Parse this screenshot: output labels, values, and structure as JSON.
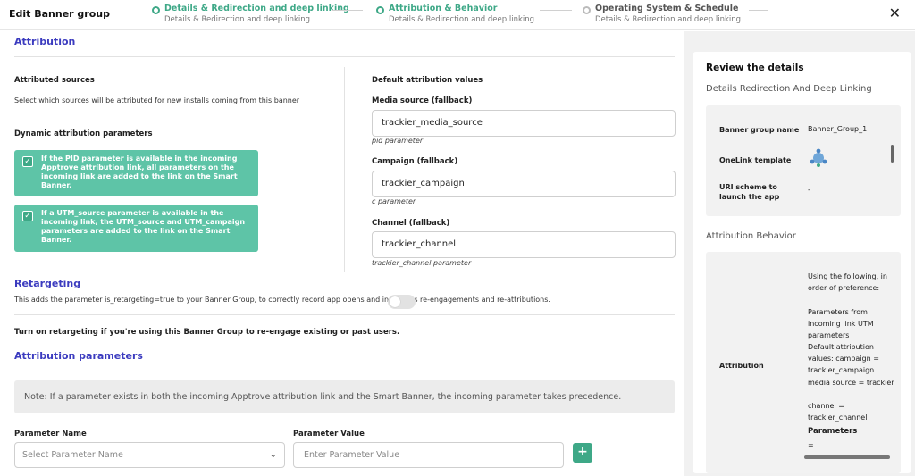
{
  "header": {
    "title": "Edit Banner group",
    "close": "✕",
    "steps": [
      {
        "title": "Details & Redirection and deep linking",
        "subtitle": "Details & Redirection and deep linking"
      },
      {
        "title": "Attribution & Behavior",
        "subtitle": "Details & Redirection and deep linking"
      },
      {
        "title": "Operating System & Schedule",
        "subtitle": "Details & Redirection and deep linking"
      }
    ]
  },
  "attribution": {
    "heading": "Attribution",
    "sources_label": "Attributed sources",
    "sources_desc": "Select which sources will be attributed for new installs coming from this banner",
    "dynamic_label": "Dynamic attribution parameters",
    "checkboxes": [
      {
        "text": "If the PID parameter is available in the incoming Apptrove attribution link, all parameters on the incoming link are added to the link on the Smart Banner.",
        "checked": true
      },
      {
        "text": "If a UTM_source parameter is available in the incoming link, the UTM_source and UTM_campaign parameters are added to the link on the Smart Banner.",
        "checked": true
      }
    ],
    "defaults_label": "Default attribution values",
    "fields": [
      {
        "label": "Media source (fallback)",
        "value": "trackier_media_source",
        "hint": "pid parameter"
      },
      {
        "label": "Campaign (fallback)",
        "value": "trackier_campaign",
        "hint": "c parameter"
      },
      {
        "label": "Channel (fallback)",
        "value": "trackier_channel",
        "hint": "trackier_channel parameter"
      }
    ]
  },
  "retargeting": {
    "heading": "Retargeting",
    "desc": "This adds the parameter is_retargeting=true to your Banner Group, to correctly record app opens and installs as re-engagements and re-attributions.",
    "toggle_label": "Turn on retargeting if you're using this Banner Group to re-engage existing or past users.",
    "enabled": false
  },
  "params": {
    "heading": "Attribution parameters",
    "note": "Note: If a parameter exists in both the incoming Apptrove attribution link and the Smart Banner, the incoming parameter takes precedence.",
    "name_label": "Parameter Name",
    "value_label": "Parameter Value",
    "name_placeholder": "Select Parameter Name",
    "value_placeholder": "Enter Parameter Value",
    "add": "+"
  },
  "review": {
    "title": "Review the details",
    "section1": "Details Redirection And Deep Linking",
    "rows": [
      {
        "key": "Banner group name",
        "value": "Banner_Group_1"
      },
      {
        "key": "OneLink template",
        "value": ""
      },
      {
        "key": "URI scheme to launch the app",
        "value": "-"
      }
    ],
    "section2": "Attribution Behavior",
    "attr_key": "Attribution",
    "attr_lines": [
      "Using the following, in order of preference:",
      "Parameters from incoming link UTM parameters",
      "Default attribution values: campaign = trackier_campaign",
      "media source = trackier_media_source",
      "channel = trackier_channel"
    ],
    "attr_params": "Parameters",
    "attr_params_value": "="
  },
  "colors": {
    "accent": "#3ea887",
    "heading": "#3b3bbf",
    "checkbox_bg": "#5ec4a7"
  },
  "icons": {
    "close": "close-icon",
    "chevron": "chevron-down-icon",
    "add": "plus-icon",
    "template": "onelink-globe-icon"
  }
}
